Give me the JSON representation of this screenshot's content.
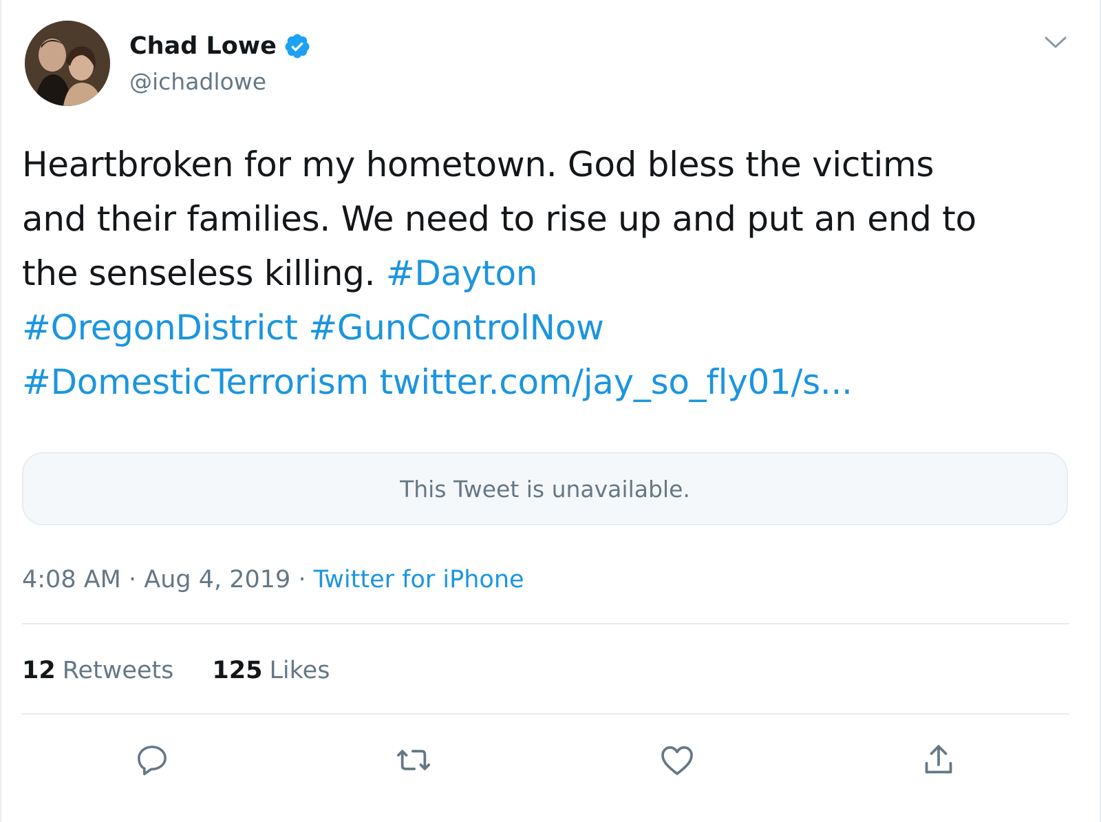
{
  "user": {
    "name": "Chad Lowe",
    "handle": "@ichadlowe"
  },
  "tweet": {
    "line1": "Heartbroken for my hometown. God bless the victims",
    "line2": "and their families. We need to rise up and put an end to",
    "line3_text": "the senseless killing. ",
    "hashtag_dayton": "#Dayton",
    "hashtag_oregon": "#OregonDistrict",
    "hashtag_guncontrol": "#GunControlNow",
    "hashtag_domestic": "#DomesticTerrorism",
    "link": "twitter.com/jay_so_fly01/s..."
  },
  "quote": {
    "unavailable_text": "This Tweet is unavailable."
  },
  "meta": {
    "time": "4:08 AM",
    "separator": " · ",
    "date": "Aug 4, 2019",
    "source": "Twitter for iPhone"
  },
  "stats": {
    "retweets_count": "12",
    "retweets_label": "Retweets",
    "likes_count": "125",
    "likes_label": "Likes"
  },
  "icons": [
    "verified-badge-icon",
    "chevron-down-icon",
    "reply-icon",
    "retweet-icon",
    "like-icon",
    "share-icon"
  ],
  "colors": {
    "link": "#1b95e0",
    "secondary_text": "#657786",
    "primary_text": "#14171a",
    "divider": "#e6ecf0",
    "verified": "#1da1f2"
  }
}
